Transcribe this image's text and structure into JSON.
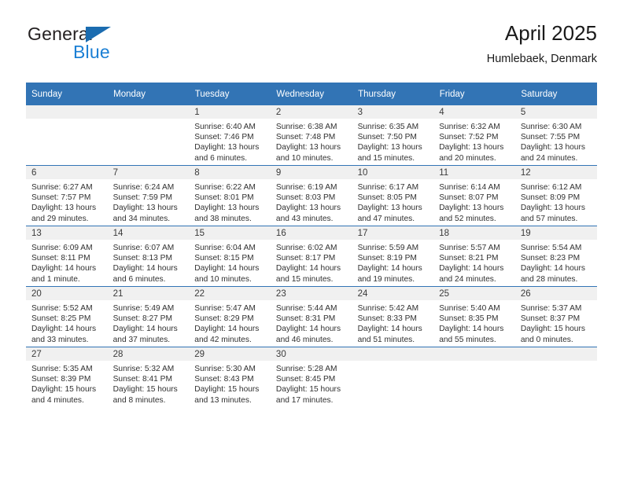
{
  "brand": {
    "name_part1": "General",
    "name_part2": "Blue",
    "logo_icon": "triangle-logo-icon"
  },
  "header": {
    "title": "April 2025",
    "subtitle": "Humlebaek, Denmark"
  },
  "calendar": {
    "weekday_headers": [
      "Sunday",
      "Monday",
      "Tuesday",
      "Wednesday",
      "Thursday",
      "Friday",
      "Saturday"
    ],
    "weeks": [
      [
        {
          "day": "",
          "sunrise": "",
          "sunset": "",
          "daylight_line1": "",
          "daylight_line2": ""
        },
        {
          "day": "",
          "sunrise": "",
          "sunset": "",
          "daylight_line1": "",
          "daylight_line2": ""
        },
        {
          "day": "1",
          "sunrise": "Sunrise: 6:40 AM",
          "sunset": "Sunset: 7:46 PM",
          "daylight_line1": "Daylight: 13 hours",
          "daylight_line2": "and 6 minutes."
        },
        {
          "day": "2",
          "sunrise": "Sunrise: 6:38 AM",
          "sunset": "Sunset: 7:48 PM",
          "daylight_line1": "Daylight: 13 hours",
          "daylight_line2": "and 10 minutes."
        },
        {
          "day": "3",
          "sunrise": "Sunrise: 6:35 AM",
          "sunset": "Sunset: 7:50 PM",
          "daylight_line1": "Daylight: 13 hours",
          "daylight_line2": "and 15 minutes."
        },
        {
          "day": "4",
          "sunrise": "Sunrise: 6:32 AM",
          "sunset": "Sunset: 7:52 PM",
          "daylight_line1": "Daylight: 13 hours",
          "daylight_line2": "and 20 minutes."
        },
        {
          "day": "5",
          "sunrise": "Sunrise: 6:30 AM",
          "sunset": "Sunset: 7:55 PM",
          "daylight_line1": "Daylight: 13 hours",
          "daylight_line2": "and 24 minutes."
        }
      ],
      [
        {
          "day": "6",
          "sunrise": "Sunrise: 6:27 AM",
          "sunset": "Sunset: 7:57 PM",
          "daylight_line1": "Daylight: 13 hours",
          "daylight_line2": "and 29 minutes."
        },
        {
          "day": "7",
          "sunrise": "Sunrise: 6:24 AM",
          "sunset": "Sunset: 7:59 PM",
          "daylight_line1": "Daylight: 13 hours",
          "daylight_line2": "and 34 minutes."
        },
        {
          "day": "8",
          "sunrise": "Sunrise: 6:22 AM",
          "sunset": "Sunset: 8:01 PM",
          "daylight_line1": "Daylight: 13 hours",
          "daylight_line2": "and 38 minutes."
        },
        {
          "day": "9",
          "sunrise": "Sunrise: 6:19 AM",
          "sunset": "Sunset: 8:03 PM",
          "daylight_line1": "Daylight: 13 hours",
          "daylight_line2": "and 43 minutes."
        },
        {
          "day": "10",
          "sunrise": "Sunrise: 6:17 AM",
          "sunset": "Sunset: 8:05 PM",
          "daylight_line1": "Daylight: 13 hours",
          "daylight_line2": "and 47 minutes."
        },
        {
          "day": "11",
          "sunrise": "Sunrise: 6:14 AM",
          "sunset": "Sunset: 8:07 PM",
          "daylight_line1": "Daylight: 13 hours",
          "daylight_line2": "and 52 minutes."
        },
        {
          "day": "12",
          "sunrise": "Sunrise: 6:12 AM",
          "sunset": "Sunset: 8:09 PM",
          "daylight_line1": "Daylight: 13 hours",
          "daylight_line2": "and 57 minutes."
        }
      ],
      [
        {
          "day": "13",
          "sunrise": "Sunrise: 6:09 AM",
          "sunset": "Sunset: 8:11 PM",
          "daylight_line1": "Daylight: 14 hours",
          "daylight_line2": "and 1 minute."
        },
        {
          "day": "14",
          "sunrise": "Sunrise: 6:07 AM",
          "sunset": "Sunset: 8:13 PM",
          "daylight_line1": "Daylight: 14 hours",
          "daylight_line2": "and 6 minutes."
        },
        {
          "day": "15",
          "sunrise": "Sunrise: 6:04 AM",
          "sunset": "Sunset: 8:15 PM",
          "daylight_line1": "Daylight: 14 hours",
          "daylight_line2": "and 10 minutes."
        },
        {
          "day": "16",
          "sunrise": "Sunrise: 6:02 AM",
          "sunset": "Sunset: 8:17 PM",
          "daylight_line1": "Daylight: 14 hours",
          "daylight_line2": "and 15 minutes."
        },
        {
          "day": "17",
          "sunrise": "Sunrise: 5:59 AM",
          "sunset": "Sunset: 8:19 PM",
          "daylight_line1": "Daylight: 14 hours",
          "daylight_line2": "and 19 minutes."
        },
        {
          "day": "18",
          "sunrise": "Sunrise: 5:57 AM",
          "sunset": "Sunset: 8:21 PM",
          "daylight_line1": "Daylight: 14 hours",
          "daylight_line2": "and 24 minutes."
        },
        {
          "day": "19",
          "sunrise": "Sunrise: 5:54 AM",
          "sunset": "Sunset: 8:23 PM",
          "daylight_line1": "Daylight: 14 hours",
          "daylight_line2": "and 28 minutes."
        }
      ],
      [
        {
          "day": "20",
          "sunrise": "Sunrise: 5:52 AM",
          "sunset": "Sunset: 8:25 PM",
          "daylight_line1": "Daylight: 14 hours",
          "daylight_line2": "and 33 minutes."
        },
        {
          "day": "21",
          "sunrise": "Sunrise: 5:49 AM",
          "sunset": "Sunset: 8:27 PM",
          "daylight_line1": "Daylight: 14 hours",
          "daylight_line2": "and 37 minutes."
        },
        {
          "day": "22",
          "sunrise": "Sunrise: 5:47 AM",
          "sunset": "Sunset: 8:29 PM",
          "daylight_line1": "Daylight: 14 hours",
          "daylight_line2": "and 42 minutes."
        },
        {
          "day": "23",
          "sunrise": "Sunrise: 5:44 AM",
          "sunset": "Sunset: 8:31 PM",
          "daylight_line1": "Daylight: 14 hours",
          "daylight_line2": "and 46 minutes."
        },
        {
          "day": "24",
          "sunrise": "Sunrise: 5:42 AM",
          "sunset": "Sunset: 8:33 PM",
          "daylight_line1": "Daylight: 14 hours",
          "daylight_line2": "and 51 minutes."
        },
        {
          "day": "25",
          "sunrise": "Sunrise: 5:40 AM",
          "sunset": "Sunset: 8:35 PM",
          "daylight_line1": "Daylight: 14 hours",
          "daylight_line2": "and 55 minutes."
        },
        {
          "day": "26",
          "sunrise": "Sunrise: 5:37 AM",
          "sunset": "Sunset: 8:37 PM",
          "daylight_line1": "Daylight: 15 hours",
          "daylight_line2": "and 0 minutes."
        }
      ],
      [
        {
          "day": "27",
          "sunrise": "Sunrise: 5:35 AM",
          "sunset": "Sunset: 8:39 PM",
          "daylight_line1": "Daylight: 15 hours",
          "daylight_line2": "and 4 minutes."
        },
        {
          "day": "28",
          "sunrise": "Sunrise: 5:32 AM",
          "sunset": "Sunset: 8:41 PM",
          "daylight_line1": "Daylight: 15 hours",
          "daylight_line2": "and 8 minutes."
        },
        {
          "day": "29",
          "sunrise": "Sunrise: 5:30 AM",
          "sunset": "Sunset: 8:43 PM",
          "daylight_line1": "Daylight: 15 hours",
          "daylight_line2": "and 13 minutes."
        },
        {
          "day": "30",
          "sunrise": "Sunrise: 5:28 AM",
          "sunset": "Sunset: 8:45 PM",
          "daylight_line1": "Daylight: 15 hours",
          "daylight_line2": "and 17 minutes."
        },
        {
          "day": "",
          "sunrise": "",
          "sunset": "",
          "daylight_line1": "",
          "daylight_line2": ""
        },
        {
          "day": "",
          "sunrise": "",
          "sunset": "",
          "daylight_line1": "",
          "daylight_line2": ""
        },
        {
          "day": "",
          "sunrise": "",
          "sunset": "",
          "daylight_line1": "",
          "daylight_line2": ""
        }
      ]
    ]
  },
  "colors": {
    "header_blue": "#3274b5",
    "brand_blue": "#1b7fd4",
    "logo_triangle_blue": "#1b6cb0",
    "daynum_band": "#f0f0f0"
  }
}
